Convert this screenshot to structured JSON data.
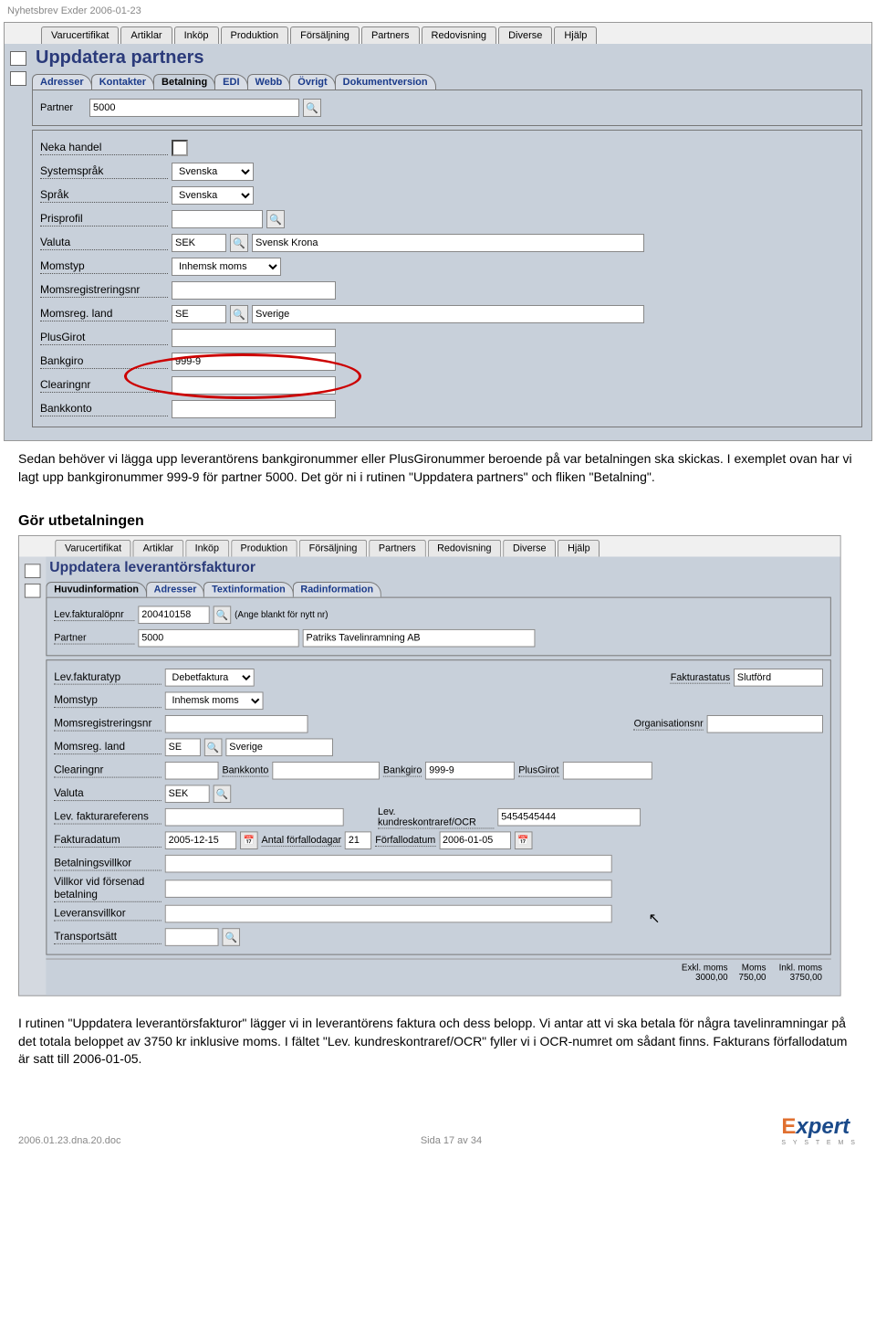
{
  "doc_header": "Nyhetsbrev Exder 2006-01-23",
  "screen1": {
    "menus": [
      "Varucertifikat",
      "Artiklar",
      "Inköp",
      "Produktion",
      "Försäljning",
      "Partners",
      "Redovisning",
      "Diverse",
      "Hjälp"
    ],
    "title": "Uppdatera partners",
    "tabs": [
      "Adresser",
      "Kontakter",
      "Betalning",
      "EDI",
      "Webb",
      "Övrigt",
      "Dokumentversion"
    ],
    "active_tab": 2,
    "partner_lbl": "Partner",
    "partner_val": "5000",
    "rows": {
      "neka_handel": "Neka handel",
      "systemsprak": "Systemspråk",
      "systemsprak_val": "Svenska",
      "sprak": "Språk",
      "sprak_val": "Svenska",
      "prisprofil": "Prisprofil",
      "valuta": "Valuta",
      "valuta_val": "SEK",
      "valuta_name": "Svensk Krona",
      "momstyp": "Momstyp",
      "momstyp_val": "Inhemsk moms",
      "momsregnr": "Momsregistreringsnr",
      "momsregland": "Momsreg. land",
      "momsregland_val": "SE",
      "momsregland_name": "Sverige",
      "plusgirot": "PlusGirot",
      "bankgiro": "Bankgiro",
      "bankgiro_val": "999-9",
      "clearingnr": "Clearingnr",
      "bankkonto": "Bankkonto"
    }
  },
  "para1": "Sedan behöver vi lägga upp leverantörens bankgironummer eller PlusGironummer beroende på var betalningen ska skickas. I exemplet ovan har vi lagt upp bankgironummer 999-9 för partner 5000. Det gör ni i rutinen \"Uppdatera partners\" och fliken \"Betalning\".",
  "heading2": "Gör utbetalningen",
  "screen2": {
    "menus": [
      "Varucertifikat",
      "Artiklar",
      "Inköp",
      "Produktion",
      "Försäljning",
      "Partners",
      "Redovisning",
      "Diverse",
      "Hjälp"
    ],
    "title": "Uppdatera leverantörsfakturor",
    "tabs": [
      "Huvudinformation",
      "Adresser",
      "Textinformation",
      "Radinformation"
    ],
    "active_tab": 0,
    "lopnr_lbl": "Lev.fakturalöpnr",
    "lopnr_val": "200410158",
    "lopnr_hint": "(Ange blankt för nytt nr)",
    "partner_lbl": "Partner",
    "partner_val": "5000",
    "partner_name": "Patriks Tavelinramning AB",
    "fakturatyp_lbl": "Lev.fakturatyp",
    "fakturatyp_val": "Debetfaktura",
    "fakturastatus_lbl": "Fakturastatus",
    "fakturastatus_val": "Slutförd",
    "momstyp_lbl": "Momstyp",
    "momstyp_val": "Inhemsk moms",
    "momsregnr_lbl": "Momsregistreringsnr",
    "orgnr_lbl": "Organisationsnr",
    "momsregland_lbl": "Momsreg. land",
    "momsregland_val": "SE",
    "momsregland_name": "Sverige",
    "clearing_lbl": "Clearingnr",
    "bankkonto_lbl": "Bankkonto",
    "bankgiro_lbl": "Bankgiro",
    "bankgiro_val": "999-9",
    "plusgirot_lbl": "PlusGirot",
    "valuta_lbl": "Valuta",
    "valuta_val": "SEK",
    "ref_lbl": "Lev. fakturareferens",
    "ocr_lbl": "Lev. kundreskontraref/OCR",
    "ocr_val": "5454545444",
    "fakturadatum_lbl": "Fakturadatum",
    "fakturadatum_val": "2005-12-15",
    "antal_lbl": "Antal förfallodagar",
    "antal_val": "21",
    "forfallo_lbl": "Förfallodatum",
    "forfallo_val": "2006-01-05",
    "betvillkor_lbl": "Betalningsvillkor",
    "villkor_forsenad_lbl": "Villkor vid försenad betalning",
    "levvillkor_lbl": "Leveransvillkor",
    "transport_lbl": "Transportsätt",
    "totals": {
      "exkl": "Exkl. moms",
      "moms": "Moms",
      "inkl": "Inkl. moms",
      "exkl_v": "3000,00",
      "moms_v": "750,00",
      "inkl_v": "3750,00"
    }
  },
  "para2": "I rutinen \"Uppdatera leverantörsfakturor\" lägger vi in leverantörens faktura och dess belopp. Vi antar att vi ska betala för några tavelinramningar på det totala beloppet av 3750 kr inklusive moms. I fältet \"Lev. kundreskontraref/OCR\" fyller vi i OCR-numret om sådant finns. Fakturans förfallodatum är satt till 2006-01-05.",
  "footer": {
    "file": "2006.01.23.dna.20.doc",
    "page": "Sida 17 av 34",
    "logo1": "E",
    "logo2": "xpert",
    "logo_sub": "S Y S T E M S"
  }
}
